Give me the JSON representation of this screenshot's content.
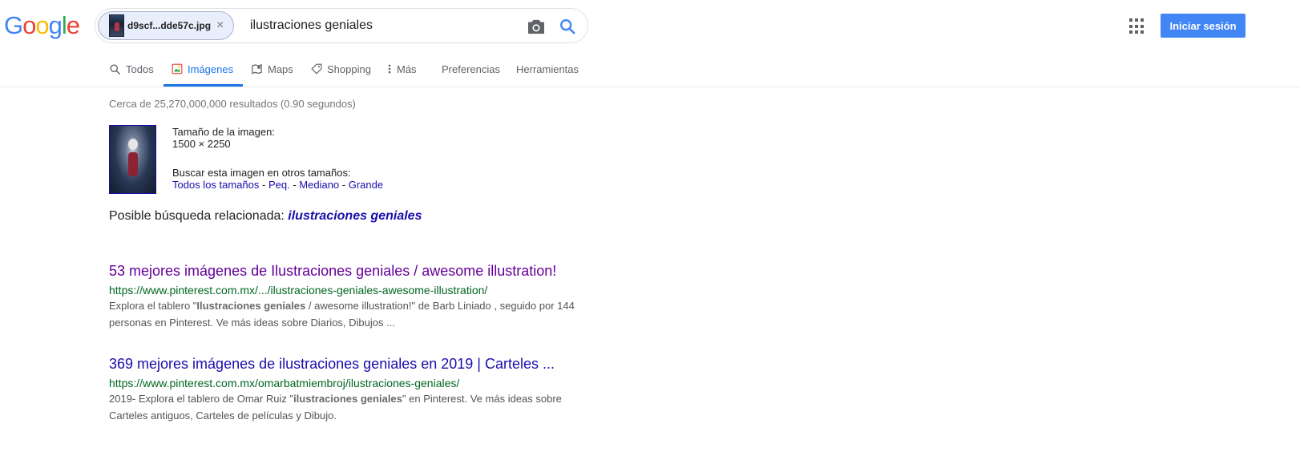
{
  "logo": {
    "letters": [
      "G",
      "o",
      "o",
      "g",
      "l",
      "e"
    ],
    "colors": [
      "#4285f4",
      "#ea4335",
      "#fbbc05",
      "#4285f4",
      "#34a853",
      "#ea4335"
    ]
  },
  "search": {
    "chip_filename": "d9scf...dde57c.jpg",
    "query": "ilustraciones geniales",
    "camera_icon": "camera-icon",
    "search_icon": "search-icon"
  },
  "header": {
    "apps_icon": "apps-grid-icon",
    "signin_label": "Iniciar sesión",
    "accent": "#4285f4"
  },
  "tabs": [
    {
      "label": "Todos",
      "icon": "search-icon",
      "active": false
    },
    {
      "label": "Imágenes",
      "icon": "image-icon",
      "active": true
    },
    {
      "label": "Maps",
      "icon": "map-icon",
      "active": false
    },
    {
      "label": "Shopping",
      "icon": "tag-icon",
      "active": false
    },
    {
      "label": "Más",
      "icon": "more-vert-icon",
      "active": false
    },
    {
      "label": "Preferencias",
      "active": false
    },
    {
      "label": "Herramientas",
      "active": false
    }
  ],
  "stats": "Cerca de 25,270,000,000 resultados (0.90 segundos)",
  "image_info": {
    "size_label": "Tamaño de la imagen:",
    "size_value": "1500 × 2250",
    "other_sizes_label": "Buscar esta imagen en otros tamaños:",
    "links": [
      "Todos los tamaños",
      "Peq.",
      "Mediano",
      "Grande"
    ],
    "separator": " - "
  },
  "related": {
    "prefix": "Posible búsqueda relacionada: ",
    "query": "ilustraciones geniales"
  },
  "results": [
    {
      "title": "53 mejores imágenes de Ilustraciones geniales / awesome illustration!",
      "url": "https://www.pinterest.com.mx/.../ilustraciones-geniales-awesome-illustration/",
      "visited": true,
      "snippet_parts": [
        {
          "text": "Explora el tablero \"",
          "bold": false
        },
        {
          "text": "Ilustraciones geniales",
          "bold": true
        },
        {
          "text": " / awesome illustration!\" de Barb Liniado , seguido por 144 personas en Pinterest. Ve más ideas sobre Diarios, Dibujos ...",
          "bold": false
        }
      ]
    },
    {
      "title": "369 mejores imágenes de ilustraciones geniales en 2019 | Carteles ...",
      "url": "https://www.pinterest.com.mx/omarbatmiembroj/ilustraciones-geniales/",
      "visited": false,
      "snippet_parts": [
        {
          "text": "2019- Explora el tablero de Omar Ruiz \"",
          "bold": false
        },
        {
          "text": "ilustraciones geniales",
          "bold": true
        },
        {
          "text": "\" en Pinterest. Ve más ideas sobre Carteles antiguos, Carteles de películas y Dibujo.",
          "bold": false
        }
      ]
    }
  ],
  "colors": {
    "link": "#1a0dab",
    "visited": "#660099",
    "url": "#006621",
    "tab_active": "#1a73e8"
  }
}
